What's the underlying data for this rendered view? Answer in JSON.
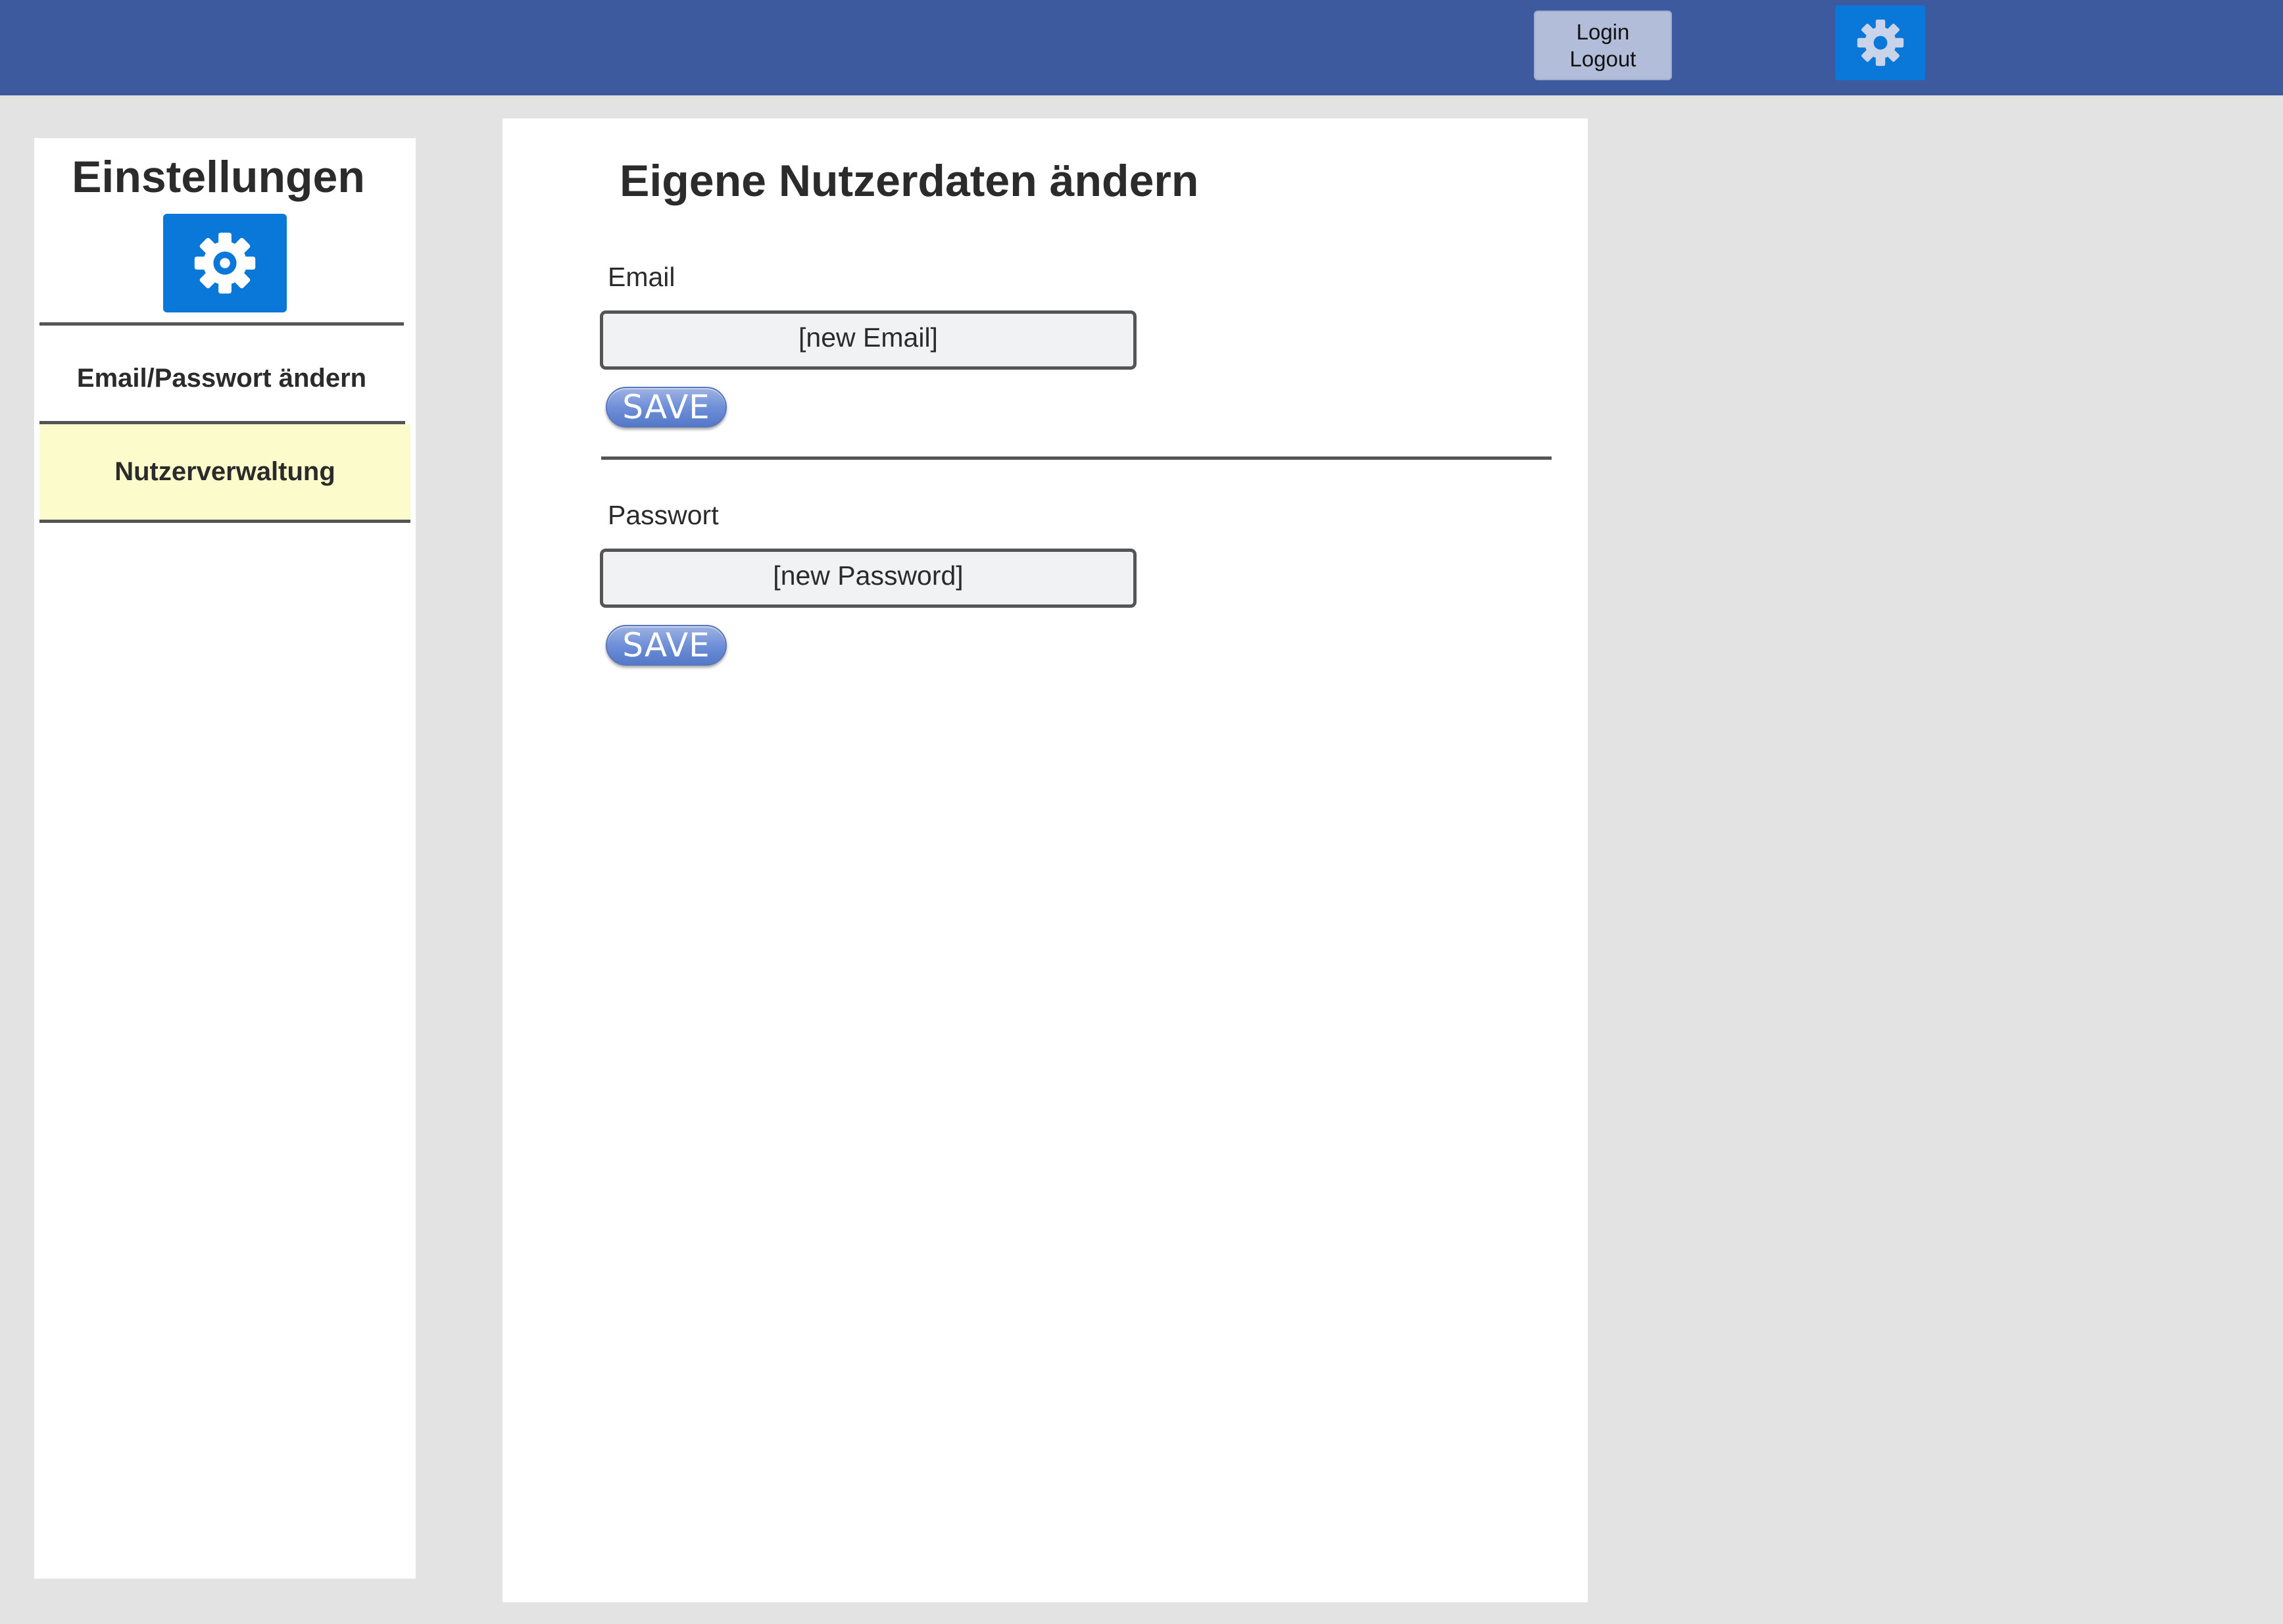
{
  "header": {
    "login_label": "Login",
    "logout_label": "Logout",
    "settings_icon": "gear-icon",
    "background_color": "#3d5a9e"
  },
  "sidebar": {
    "title": "Einstellungen",
    "icon": "gear-icon",
    "items": [
      {
        "label": "Email/Passwort ändern",
        "selected": false
      },
      {
        "label": "Nutzerverwaltung",
        "selected": true,
        "highlight_color": "#fbfbcb"
      }
    ]
  },
  "main": {
    "title": "Eigene Nutzerdaten ändern",
    "email": {
      "label": "Email",
      "placeholder": "[new Email]",
      "save_label": "SAVE"
    },
    "password": {
      "label": "Passwort",
      "placeholder": "[new Password]",
      "save_label": "SAVE"
    }
  },
  "colors": {
    "accent": "#0a78d8",
    "save_button": "#6f8fd8"
  }
}
